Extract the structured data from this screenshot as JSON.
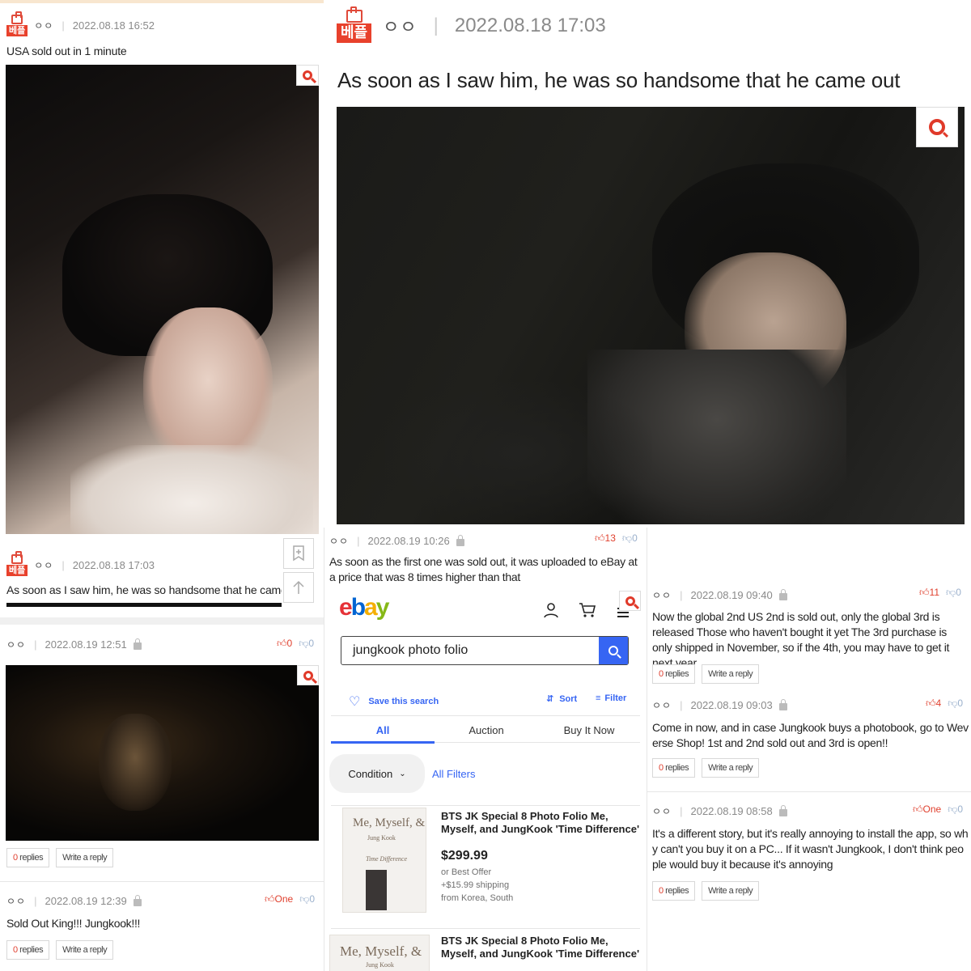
{
  "badge_label": "베플",
  "nick": "ㅇㅇ",
  "post1": {
    "date": "2022.08.18 16:52",
    "text": "USA sold out in 1 minute"
  },
  "post2": {
    "date": "2022.08.18 17:03",
    "text": "As soon as I saw him, he was so handsome that he came out"
  },
  "post3": {
    "date": "2022.08.18 17:03",
    "text": "As soon as I saw him, he was so handsome that he came out"
  },
  "comment_a": {
    "date": "2022.08.19 12:51",
    "up": "0",
    "down": "0",
    "replies_count": "0",
    "replies_word": " replies",
    "write": "Write a reply"
  },
  "comment_b": {
    "date": "2022.08.19 12:39",
    "up": "One",
    "down": "0",
    "text": "Sold Out King!!! Jungkook!!!",
    "replies_count": "0",
    "replies_word": " replies",
    "write": "Write a reply"
  },
  "comment_c": {
    "date": "2022.08.19 10:26",
    "up": "13",
    "down": "0",
    "text": "As soon as the first one was sold out, it was uploaded to eBay at a price that was 8 times higher than that"
  },
  "comment_d": {
    "date": "2022.08.19 09:40",
    "up": "11",
    "down": "0",
    "text": "Now the global 2nd US 2nd is sold out, only the global 3rd is released Those who haven't bought it yet The 3rd purchase is only shipped in November, so if the 4th, you may have to get it next year",
    "replies_count": "0",
    "replies_word": " replies",
    "write": "Write a reply"
  },
  "comment_e": {
    "date": "2022.08.19 09:03",
    "up": "4",
    "down": "0",
    "text": "Come in now, and in case Jungkook buys a photobook, go to Weverse Shop! 1st and 2nd sold out and 3rd is open!!",
    "replies_count": "0",
    "replies_word": " replies",
    "write": "Write a reply"
  },
  "comment_f": {
    "date": "2022.08.19 08:58",
    "up": "One",
    "down": "0",
    "text": "It's a different story, but it's really annoying to install the app, so why can't you buy it on a PC... If it wasn't Jungkook, I don't think people would buy it because it's annoying",
    "replies_count": "0",
    "replies_word": " replies",
    "write": "Write a reply"
  },
  "ebay": {
    "logo": [
      "e",
      "b",
      "a",
      "y"
    ],
    "search_query": "jungkook photo folio",
    "save_search": "Save this search",
    "sort": "Sort",
    "filter": "Filter",
    "tabs": [
      "All",
      "Auction",
      "Buy It Now"
    ],
    "condition": "Condition",
    "all_filters": "All Filters",
    "listing1": {
      "img_text": "Me, Myself, &",
      "img_sub1": "Jung Kook",
      "img_sub2": "Time Difference",
      "title": "BTS JK Special 8 Photo Folio Me, Myself, and JungKook 'Time Difference' + Tracki",
      "price": "$299.99",
      "offer": "or Best Offer",
      "shipping": "+$15.99 shipping",
      "from": "from Korea, South"
    },
    "listing2": {
      "img_text": "Me, Myself, &",
      "img_sub1": "Jung Kook",
      "title": "BTS JK Special 8 Photo Folio Me, Myself, and JungKook 'Time Difference'"
    }
  },
  "colors": {
    "accent_red": "#e8412c",
    "ebay_blue": "#3665f3",
    "vote_down": "#9ab0cc"
  }
}
